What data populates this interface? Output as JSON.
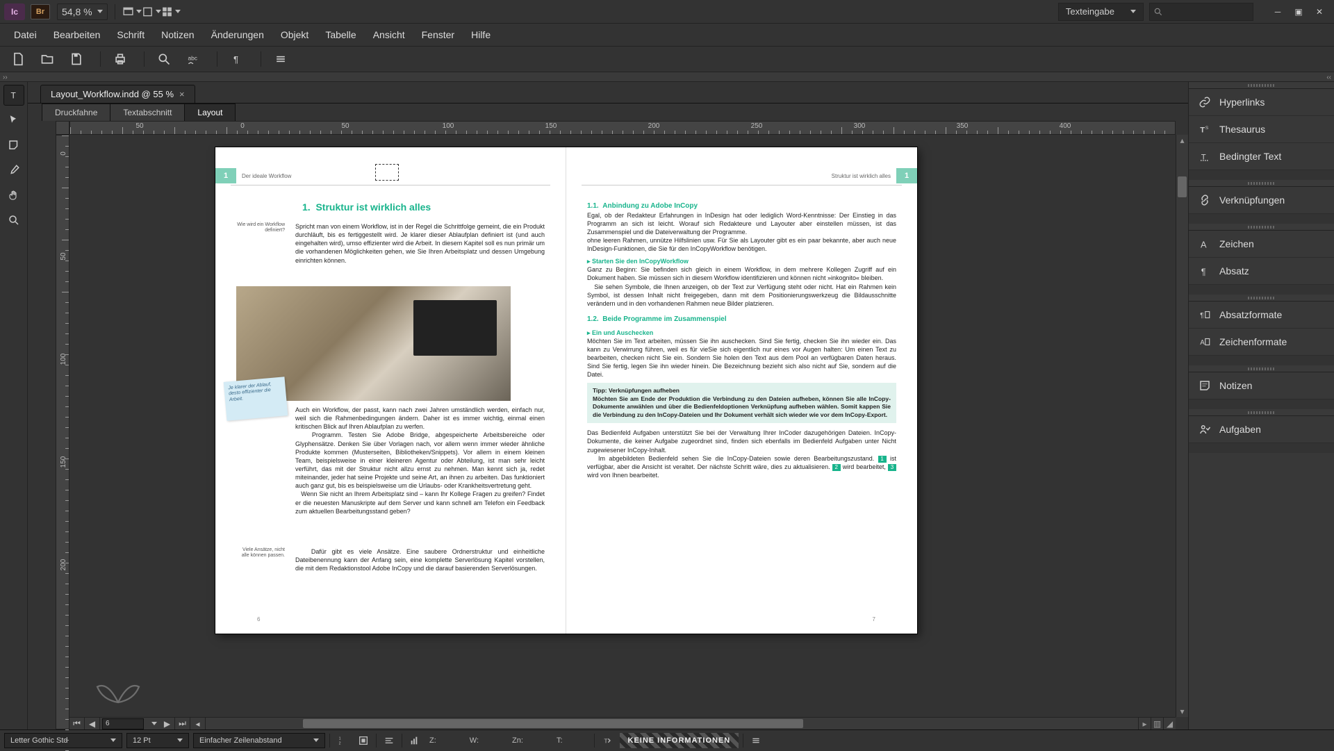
{
  "titlebar": {
    "app_icon_text": "Ic",
    "br_text": "Br",
    "zoom": "54,8 %",
    "mode": "Texteingabe"
  },
  "menu": {
    "items": [
      "Datei",
      "Bearbeiten",
      "Schrift",
      "Notizen",
      "Änderungen",
      "Objekt",
      "Tabelle",
      "Ansicht",
      "Fenster",
      "Hilfe"
    ]
  },
  "document": {
    "tab_title": "Layout_Workflow.indd @ 55 %",
    "view_tabs": {
      "druckfahne": "Druckfahne",
      "textabschnitt": "Textabschnitt",
      "layout": "Layout"
    }
  },
  "hruler": {
    "labels": [
      "50",
      "0",
      "50",
      "100",
      "150",
      "200",
      "250",
      "300",
      "350",
      "400"
    ]
  },
  "vruler": {
    "labels": [
      "0",
      "50",
      "100",
      "150",
      "200"
    ]
  },
  "scroll": {
    "page_field": "6"
  },
  "left_page": {
    "num": "1",
    "runtitle": "Der ideale Workflow",
    "h1_num": "1.",
    "h1_text": "Struktur ist wirklich alles",
    "sidenote1": "Wie wird ein Workflow definiert?",
    "para1": "Spricht man von einem Workflow, ist in der Regel die Schrittfolge gemeint, die ein Produkt durchläuft, bis es fertiggestellt wird. Je klarer dieser Ablaufplan definiert ist (und auch eingehalten wird), umso effizienter wird die Arbeit. In diesem Kapitel soll es nun primär um die vorhandenen Möglichkeiten gehen, wie Sie Ihren Arbeitsplatz und dessen Umgebung einrichten können.",
    "sticky": "Je klarer der Ablauf, desto effizienter die Arbeit.",
    "para2": "Auch ein Workflow, der passt, kann nach zwei Jahren umständlich werden, einfach nur, weil sich die Rahmenbedingungen ändern. Daher ist es immer wichtig, einmal einen kritischen Blick auf Ihren Ablaufplan zu werfen.",
    "para3": "Programm. Testen Sie Adobe Bridge, abgespeicherte Arbeitsbereiche oder Glyphensätze. Denken Sie über Vorlagen nach, vor allem wenn immer wieder ähnliche Produkte kommen (Musterseiten, Bibliotheken/Snippets). Vor allem in einem kleinen Team, beispielsweise in einer kleineren Agentur oder Abteilung, ist man sehr leicht verführt, das mit der Struktur nicht allzu ernst zu nehmen. Man kennt sich ja, redet miteinander, jeder hat seine Projekte und seine Art, an ihnen zu arbeiten. Das funktioniert auch ganz gut, bis es beispielsweise um die Urlaubs- oder Krankheitsvertretung geht.",
    "para4": "Wenn Sie nicht an Ihrem Arbeitsplatz sind – kann Ihr Kollege Fragen zu greifen? Findet er die neuesten Manuskripte auf dem Server und kann schnell am Telefon ein Feedback zum aktuellen Bearbeitungsstand geben?",
    "sidenote2": "Viele Ansätze, nicht alle können passen.",
    "para5": "Dafür gibt es viele Ansätze. Eine saubere Ordnerstruktur und einheitliche Dateibenennung kann der Anfang sein, eine komplette Serverlösung Kapitel vorstellen, die mit dem Redaktionstool Adobe InCopy und die darauf basierenden Serverlösungen.",
    "folio": "6"
  },
  "right_page": {
    "num": "1",
    "runtitle": "Struktur ist wirklich alles",
    "h11_num": "1.1.",
    "h11_text": "Anbindung zu Adobe InCopy",
    "para1": "Egal, ob der Redakteur Erfahrungen in InDesign hat oder lediglich Word-Kenntnisse: Der Einstieg in das Programm an sich ist leicht. Worauf sich Redakteure und Layouter aber einstellen müssen, ist das Zusammenspiel und die Dateiverwaltung der Programme.",
    "para1b": "ohne leeren Rahmen, unnütze Hilfslinien usw. Für Sie als Layouter gibt es ein paar bekannte, aber auch neue InDesign-Funktionen, die Sie für den InCopyWorkflow benötigen.",
    "sub1": "▸  Starten Sie den InCopyWorkflow",
    "para2": "Ganz zu Beginn: Sie befinden sich gleich in einem Workflow, in dem mehrere Kollegen Zugriff auf ein Dokument haben. Sie müssen sich in diesem Workflow identifizieren und können nicht »inkognito« bleiben.",
    "para2b": "Sie sehen Symbole, die Ihnen anzeigen, ob der Text zur Verfügung steht oder nicht. Hat ein Rahmen kein Symbol, ist dessen Inhalt nicht freigegeben, dann mit dem Positionierungswerkzeug die Bildausschnitte verändern und in den vorhandenen Rahmen neue Bilder platzieren.",
    "h12_num": "1.2.",
    "h12_text": "Beide Programme im Zusammenspiel",
    "sub2": "▸  Ein und Auschecken",
    "para3": "Möchten Sie im Text arbeiten, müssen Sie ihn auschecken. Sind Sie fertig, checken Sie ihn wieder ein. Das kann zu Verwirrung führen, weil es für vieSie sich eigentlich nur eines vor Augen halten: Um einen Text zu bearbeiten, checken nicht Sie ein. Sondern Sie holen den Text aus dem Pool an verfügbaren Daten heraus. Sind Sie fertig, legen Sie ihn wieder hinein. Die Bezeichnung bezieht sich also nicht auf Sie, sondern auf die Datei.",
    "tip_title": "Tipp: Verknüpfungen aufheben",
    "tip_body": "Möchten Sie am Ende der Produktion die Verbindung zu den Dateien aufheben, können Sie alle InCopy-Dokumente anwählen und über die Bedienfeldoptionen Verknüpfung aufheben wählen. Somit kappen Sie die Verbindung zu den InCopy-Dateien und Ihr Dokument verhält sich wieder wie vor dem InCopy-Export.",
    "para4a": "Das Bedienfeld Aufgaben unterstützt Sie bei der Verwaltung Ihrer InCoder dazugehörigen Dateien. InCopy-Dokumente, die keiner Aufgabe zugeordnet sind, finden sich ebenfalls im Bedienfeld Aufgaben unter Nicht zugewiesener InCopy-Inhalt.",
    "para4b_pre": "Im abgebildeten Bedienfeld sehen Sie die InCopy-Dateien sowie deren Bearbeitungszustand. ",
    "para4b_m1": "1",
    "para4b_mid1": " ist verfügbar, aber die Ansicht ist veraltet. Der nächste Schritt wäre, dies zu aktualisieren. ",
    "para4b_m2": "2",
    "para4b_mid2": " wird bearbeitet, ",
    "para4b_m3": "3",
    "para4b_end": " wird von Ihnen bearbeitet.",
    "folio": "7"
  },
  "panels": {
    "items": [
      {
        "id": "hyperlinks",
        "label": "Hyperlinks"
      },
      {
        "id": "thesaurus",
        "label": "Thesaurus"
      },
      {
        "id": "conditional",
        "label": "Bedingter Text"
      },
      {
        "id": "links",
        "label": "Verknüpfungen"
      },
      {
        "id": "character",
        "label": "Zeichen"
      },
      {
        "id": "paragraph",
        "label": "Absatz"
      },
      {
        "id": "parastyles",
        "label": "Absatzformate"
      },
      {
        "id": "charstyles",
        "label": "Zeichenformate"
      },
      {
        "id": "notes",
        "label": "Notizen"
      },
      {
        "id": "assignments",
        "label": "Aufgaben"
      }
    ],
    "groups": [
      [
        0,
        1,
        2
      ],
      [
        3
      ],
      [
        4,
        5
      ],
      [
        6,
        7
      ],
      [
        8
      ],
      [
        9
      ]
    ]
  },
  "statusbar": {
    "font": "Letter Gothic Std",
    "fontsize": "12 Pt",
    "leading": "Einfacher Zeilenabstand",
    "col": "1",
    "z": "Z:",
    "w": "W:",
    "zn": "Zn:",
    "t": "T:",
    "info": "KEINE INFORMATIONEN"
  }
}
